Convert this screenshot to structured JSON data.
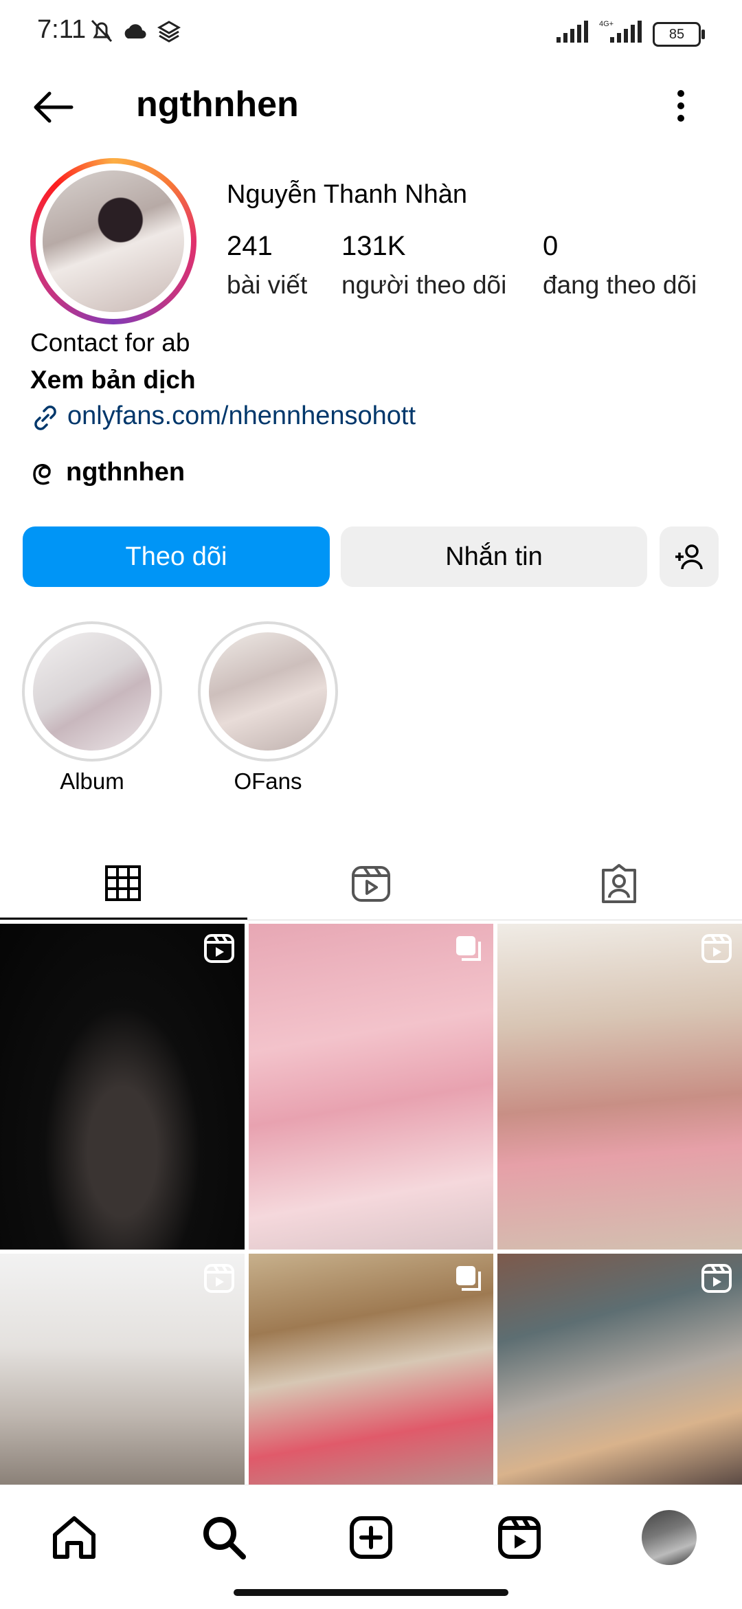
{
  "status_bar": {
    "time": "7:11",
    "battery": "85"
  },
  "header": {
    "title": "ngthnhen"
  },
  "profile": {
    "full_name": "Nguyễn Thanh Nhàn",
    "stats": [
      {
        "value": "241",
        "label": "bài viết"
      },
      {
        "value": "131K",
        "label": "người theo dõi"
      },
      {
        "value": "0",
        "label": "đang theo dõi"
      }
    ],
    "bio": "Contact for ab",
    "translate": "Xem bản dịch",
    "link": "onlyfans.com/nhennhensohott",
    "threads_handle": "ngthnhen"
  },
  "actions": {
    "follow": "Theo dõi",
    "message": "Nhắn tin"
  },
  "highlights": [
    {
      "label": "Album"
    },
    {
      "label": "OFans"
    }
  ],
  "colors": {
    "accent": "#0095f6",
    "link": "#00376b",
    "secondary_button": "#efefef"
  }
}
